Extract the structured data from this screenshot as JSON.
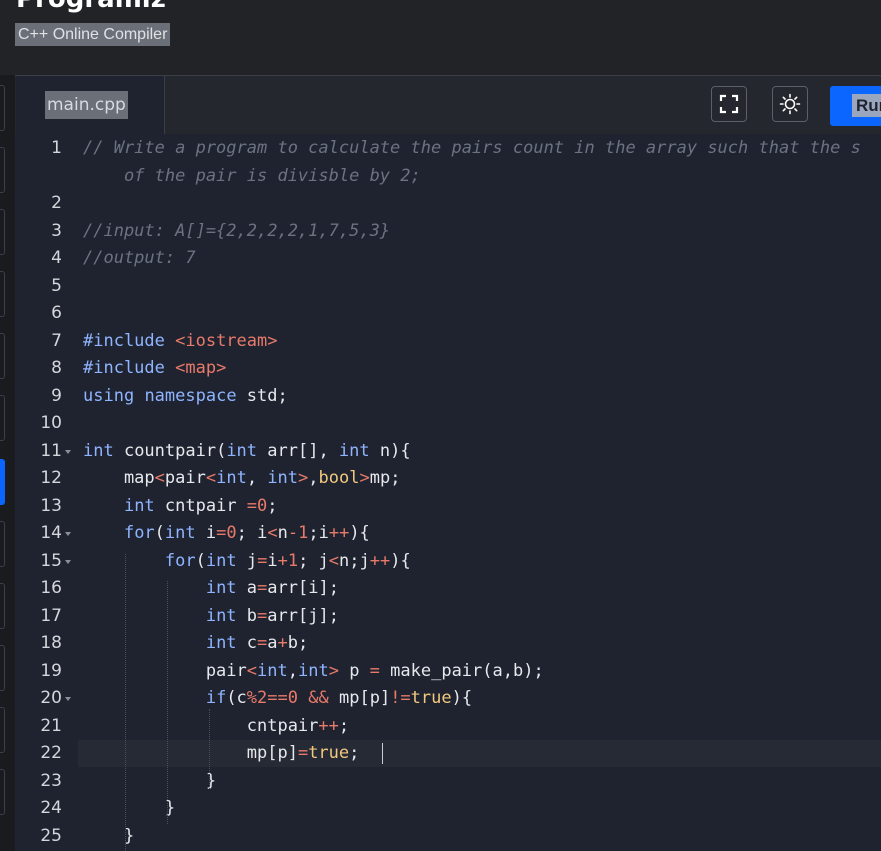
{
  "header": {
    "brand": "Programiz",
    "subtitle": "C++ Online Compiler"
  },
  "toolbar": {
    "file_name": "main.cpp",
    "fullscreen_icon": "fullscreen-icon",
    "theme_icon": "sun-icon",
    "run_label": "Run"
  },
  "editor": {
    "active_line": 22,
    "lines": [
      {
        "n": "1",
        "parts": [
          [
            "comment",
            "// Write a program to calculate the pairs count in the array such that the s"
          ]
        ]
      },
      {
        "n": "",
        "parts": [
          [
            "comment",
            "    of the pair is divisble by 2;"
          ]
        ]
      },
      {
        "n": "2",
        "parts": []
      },
      {
        "n": "3",
        "parts": [
          [
            "comment",
            "//input: A[]={2,2,2,2,1,7,5,3}"
          ]
        ]
      },
      {
        "n": "4",
        "parts": [
          [
            "comment",
            "//output: 7"
          ]
        ]
      },
      {
        "n": "5",
        "parts": []
      },
      {
        "n": "6",
        "parts": []
      },
      {
        "n": "7",
        "parts": [
          [
            "inc",
            "#include "
          ],
          [
            "str",
            "<iostream>"
          ]
        ]
      },
      {
        "n": "8",
        "parts": [
          [
            "inc",
            "#include "
          ],
          [
            "str",
            "<map>"
          ]
        ]
      },
      {
        "n": "9",
        "parts": [
          [
            "kw",
            "using"
          ],
          [
            "plain",
            " "
          ],
          [
            "kw",
            "namespace"
          ],
          [
            "plain",
            " std;"
          ]
        ]
      },
      {
        "n": "10",
        "parts": []
      },
      {
        "n": "11",
        "fold": true,
        "parts": [
          [
            "kw",
            "int"
          ],
          [
            "plain",
            " countpair("
          ],
          [
            "kw",
            "int"
          ],
          [
            "plain",
            " arr[], "
          ],
          [
            "kw",
            "int"
          ],
          [
            "plain",
            " n){"
          ]
        ]
      },
      {
        "n": "12",
        "parts": [
          [
            "plain",
            "    map"
          ],
          [
            "op",
            "<"
          ],
          [
            "plain",
            "pair"
          ],
          [
            "op",
            "<"
          ],
          [
            "kw",
            "int"
          ],
          [
            "plain",
            ", "
          ],
          [
            "kw",
            "int"
          ],
          [
            "op",
            ">"
          ],
          [
            "plain",
            ","
          ],
          [
            "type",
            "bool"
          ],
          [
            "op",
            ">"
          ],
          [
            "plain",
            "mp;"
          ]
        ]
      },
      {
        "n": "13",
        "parts": [
          [
            "plain",
            "    "
          ],
          [
            "kw",
            "int"
          ],
          [
            "plain",
            " cntpair "
          ],
          [
            "op",
            "="
          ],
          [
            "num",
            "0"
          ],
          [
            "plain",
            ";"
          ]
        ]
      },
      {
        "n": "14",
        "fold": true,
        "parts": [
          [
            "plain",
            "    "
          ],
          [
            "kw",
            "for"
          ],
          [
            "plain",
            "("
          ],
          [
            "kw",
            "int"
          ],
          [
            "plain",
            " i"
          ],
          [
            "op",
            "="
          ],
          [
            "num",
            "0"
          ],
          [
            "plain",
            "; i"
          ],
          [
            "op",
            "<"
          ],
          [
            "plain",
            "n"
          ],
          [
            "op",
            "-"
          ],
          [
            "num",
            "1"
          ],
          [
            "plain",
            ";i"
          ],
          [
            "op",
            "++"
          ],
          [
            "plain",
            "){"
          ]
        ]
      },
      {
        "n": "15",
        "fold": true,
        "parts": [
          [
            "plain",
            "        "
          ],
          [
            "kw",
            "for"
          ],
          [
            "plain",
            "("
          ],
          [
            "kw",
            "int"
          ],
          [
            "plain",
            " j"
          ],
          [
            "op",
            "="
          ],
          [
            "plain",
            "i"
          ],
          [
            "op",
            "+"
          ],
          [
            "num",
            "1"
          ],
          [
            "plain",
            "; j"
          ],
          [
            "op",
            "<"
          ],
          [
            "plain",
            "n;j"
          ],
          [
            "op",
            "++"
          ],
          [
            "plain",
            "){"
          ]
        ]
      },
      {
        "n": "16",
        "parts": [
          [
            "plain",
            "            "
          ],
          [
            "kw",
            "int"
          ],
          [
            "plain",
            " a"
          ],
          [
            "op",
            "="
          ],
          [
            "plain",
            "arr[i];"
          ]
        ]
      },
      {
        "n": "17",
        "parts": [
          [
            "plain",
            "            "
          ],
          [
            "kw",
            "int"
          ],
          [
            "plain",
            " b"
          ],
          [
            "op",
            "="
          ],
          [
            "plain",
            "arr[j];"
          ]
        ]
      },
      {
        "n": "18",
        "parts": [
          [
            "plain",
            "            "
          ],
          [
            "kw",
            "int"
          ],
          [
            "plain",
            " c"
          ],
          [
            "op",
            "="
          ],
          [
            "plain",
            "a"
          ],
          [
            "op",
            "+"
          ],
          [
            "plain",
            "b;"
          ]
        ]
      },
      {
        "n": "19",
        "parts": [
          [
            "plain",
            "            pair"
          ],
          [
            "op",
            "<"
          ],
          [
            "kw",
            "int"
          ],
          [
            "plain",
            ","
          ],
          [
            "kw",
            "int"
          ],
          [
            "op",
            ">"
          ],
          [
            "plain",
            " p "
          ],
          [
            "op",
            "="
          ],
          [
            "plain",
            " make_pair(a,b);"
          ]
        ]
      },
      {
        "n": "20",
        "fold": true,
        "parts": [
          [
            "plain",
            "            "
          ],
          [
            "kw",
            "if"
          ],
          [
            "plain",
            "(c"
          ],
          [
            "op",
            "%"
          ],
          [
            "num",
            "2"
          ],
          [
            "op",
            "=="
          ],
          [
            "num",
            "0"
          ],
          [
            "plain",
            " "
          ],
          [
            "op",
            "&&"
          ],
          [
            "plain",
            " mp[p]"
          ],
          [
            "op",
            "!="
          ],
          [
            "type",
            "true"
          ],
          [
            "plain",
            "){"
          ]
        ]
      },
      {
        "n": "21",
        "parts": [
          [
            "plain",
            "                cntpair"
          ],
          [
            "op",
            "++"
          ],
          [
            "plain",
            ";"
          ]
        ]
      },
      {
        "n": "22",
        "parts": [
          [
            "plain",
            "                mp[p]"
          ],
          [
            "op",
            "="
          ],
          [
            "type",
            "true"
          ],
          [
            "plain",
            ";"
          ]
        ]
      },
      {
        "n": "23",
        "parts": [
          [
            "plain",
            "            }"
          ]
        ]
      },
      {
        "n": "24",
        "parts": [
          [
            "plain",
            "        }"
          ]
        ]
      },
      {
        "n": "25",
        "parts": [
          [
            "plain",
            "    }"
          ]
        ]
      }
    ]
  }
}
